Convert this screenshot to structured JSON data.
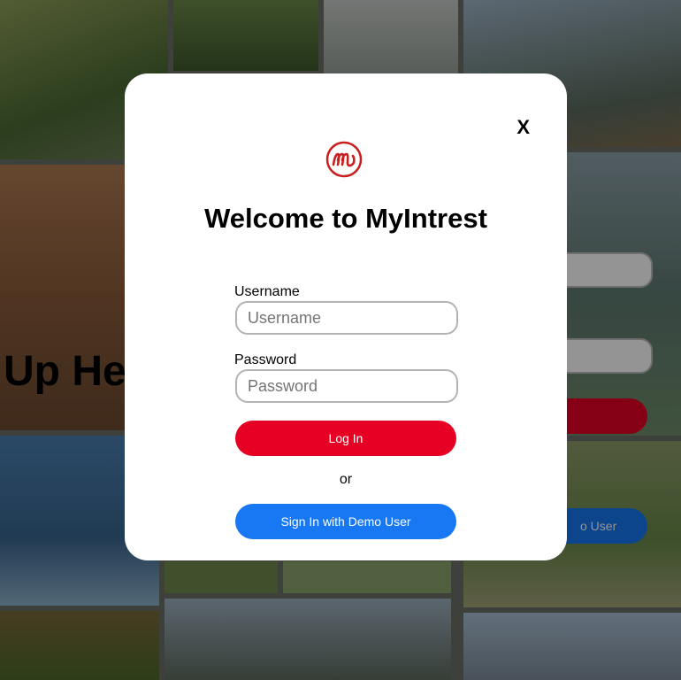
{
  "background": {
    "heading_fragment": "Up He",
    "demo_button_fragment": "o User"
  },
  "modal": {
    "close_label": "X",
    "logo_icon": "myintrest-logo-icon",
    "title": "Welcome to MyIntrest",
    "username_label": "Username",
    "username_placeholder": "Username",
    "username_value": "",
    "password_label": "Password",
    "password_placeholder": "Password",
    "password_value": "",
    "login_label": "Log In",
    "or_text": "or",
    "demo_label": "Sign In with Demo User"
  },
  "colors": {
    "brand_red": "#e60023",
    "demo_blue": "#1877f2",
    "logo_red": "#c8201e"
  }
}
